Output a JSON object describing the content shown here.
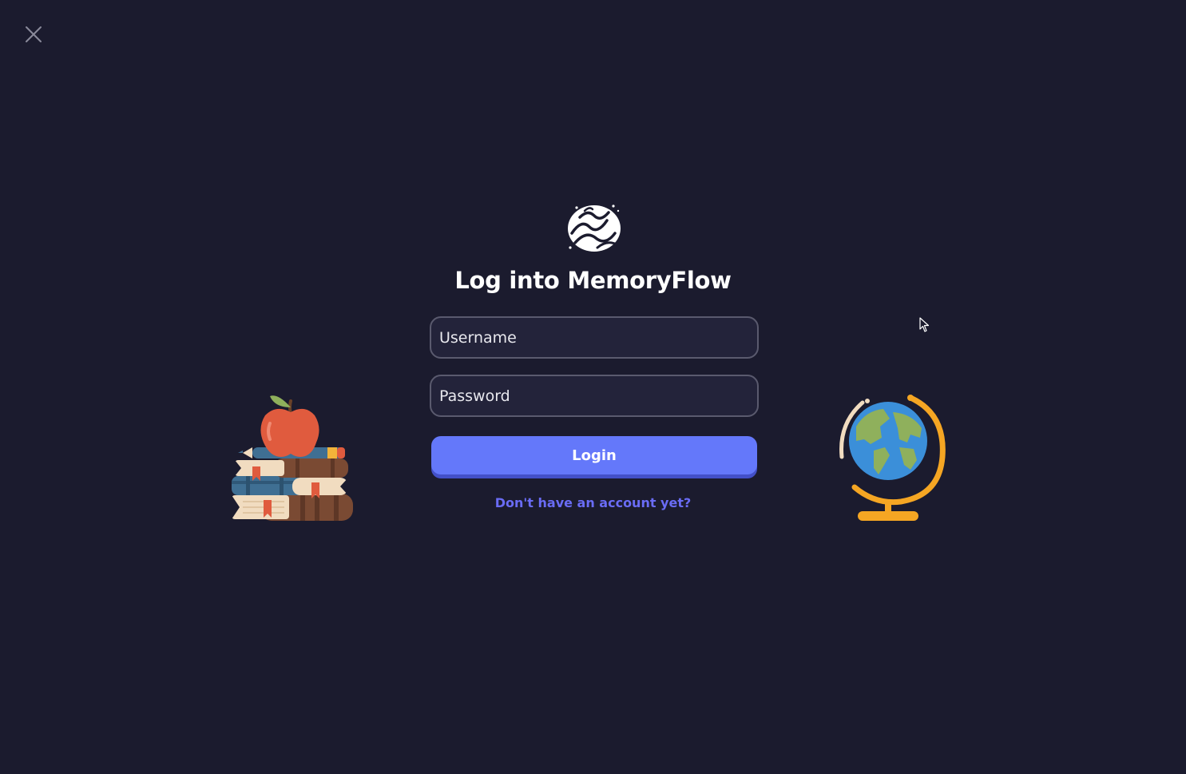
{
  "app": {
    "title": "Log into MemoryFlow"
  },
  "form": {
    "username_placeholder": "Username",
    "username_value": "",
    "password_placeholder": "Password",
    "password_value": "",
    "login_label": "Login",
    "signup_link": "Don't have an account yet?"
  },
  "icons": {
    "close": "close-icon",
    "logo": "brain-logo-icon",
    "left_illustration": "books-apple-icon",
    "right_illustration": "globe-icon",
    "cursor": "mouse-pointer-icon"
  },
  "colors": {
    "background": "#1b1b2e",
    "accent": "#6478fa",
    "link": "#6a6cf5",
    "field_border": "#5a5a6e"
  }
}
